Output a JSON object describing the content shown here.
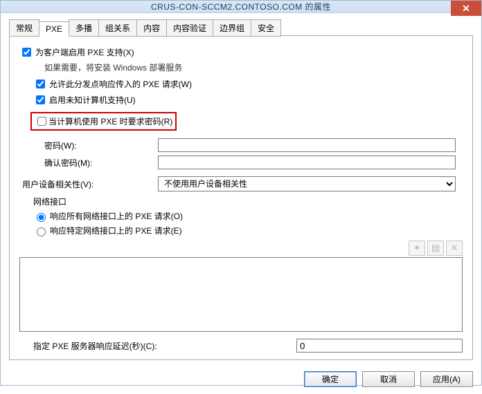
{
  "title": "CRUS-CON-SCCM2.CONTOSO.COM 的属性",
  "tabs": {
    "t0": "常规",
    "t1": "PXE",
    "t2": "多播",
    "t3": "组关系",
    "t4": "内容",
    "t5": "内容验证",
    "t6": "边界组",
    "t7": "安全"
  },
  "pxe": {
    "enable_support": "为客户端启用 PXE 支持(X)",
    "hint_install": "如果需要，将安装 Windows 部署服务",
    "allow_incoming": "允许此分发点响应传入的 PXE 请求(W)",
    "unknown_support": "启用未知计算机支持(U)",
    "require_password": "当计算机使用 PXE 时要求密码(R)",
    "password_label": "密码(W):",
    "confirm_label": "确认密码(M):",
    "password_value": "",
    "confirm_value": "",
    "uda_label": "用户设备相关性(V):",
    "uda_selected": "不使用用户设备相关性",
    "network_group": "网络接口",
    "radio_all": "响应所有网络接口上的 PXE 请求(O)",
    "radio_specific": "响应特定网络接口上的 PXE 请求(E)",
    "delay_label": "指定 PXE 服务器响应延迟(秒)(C):",
    "delay_value": "0"
  },
  "icons": {
    "add": "✶",
    "edit": "▤",
    "delete": "✕"
  },
  "buttons": {
    "ok": "确定",
    "cancel": "取消",
    "apply": "应用(A)"
  }
}
